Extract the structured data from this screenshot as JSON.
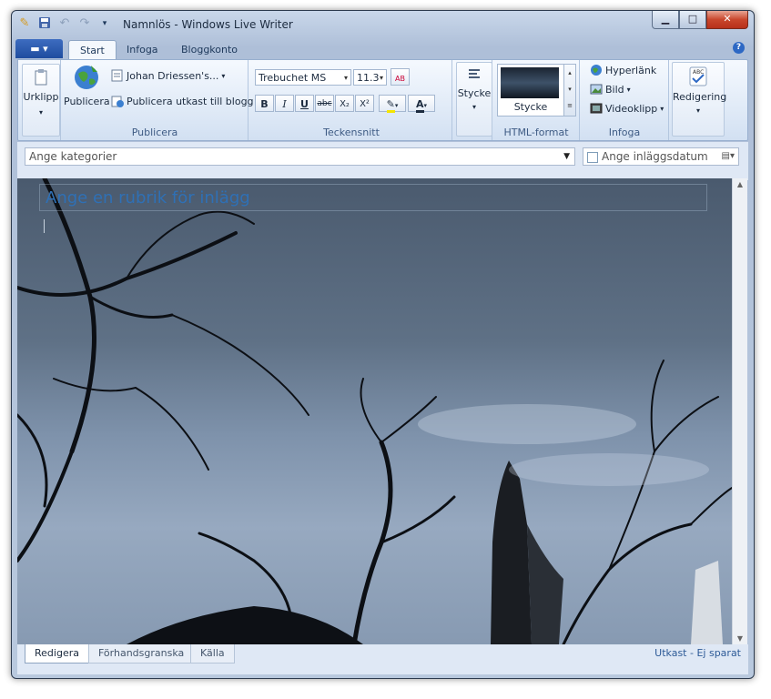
{
  "window": {
    "title": "Namnlös - Windows Live Writer",
    "minimize": "▁",
    "maximize": "□",
    "close": "✕"
  },
  "tabs": [
    {
      "label": "Start",
      "active": true
    },
    {
      "label": "Infoga",
      "active": false
    },
    {
      "label": "Bloggkonto",
      "active": false
    }
  ],
  "ribbon": {
    "clipboard": {
      "label": "Urklipp"
    },
    "publish_group": {
      "publish": "Publicera",
      "account": "Johan Driessen's...",
      "draft": "Publicera utkast till blogg",
      "group_label": "Publicera"
    },
    "font_group": {
      "font_name": "Trebuchet MS",
      "font_size": "11.3",
      "bold": "B",
      "italic": "I",
      "underline": "U",
      "strike": "abc",
      "subscript": "X₂",
      "superscript": "X²",
      "font_color": "A",
      "group_label": "Teckensnitt"
    },
    "paragraph": {
      "label": "Stycke"
    },
    "html_format": {
      "style_label": "Stycke",
      "group_label": "HTML-format"
    },
    "insert_group": {
      "hyperlink": "Hyperlänk",
      "image": "Bild",
      "video": "Videoklipp",
      "group_label": "Infoga"
    },
    "editing": {
      "label": "Redigering"
    }
  },
  "category": {
    "placeholder": "Ange kategorier"
  },
  "date": {
    "label": "Ange inläggsdatum"
  },
  "editor": {
    "title_placeholder": "Ange en rubrik för inlägg"
  },
  "bottom_tabs": [
    {
      "label": "Redigera",
      "active": true
    },
    {
      "label": "Förhandsgranska",
      "active": false
    },
    {
      "label": "Källa",
      "active": false
    }
  ],
  "status": "Utkast - Ej sparat",
  "colors": {
    "accent": "#1f4d9f",
    "title_placeholder": "#2f70b5",
    "close": "#c9462c"
  }
}
